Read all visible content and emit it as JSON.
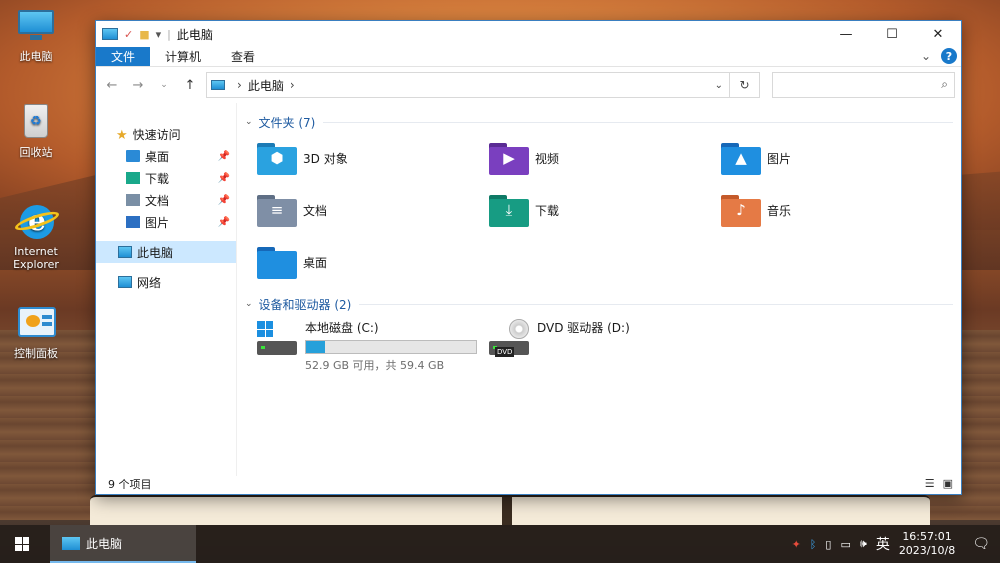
{
  "desktop": {
    "icons": [
      {
        "label": "此电脑"
      },
      {
        "label": "回收站"
      },
      {
        "label": "Internet Explorer"
      },
      {
        "label": "控制面板"
      }
    ]
  },
  "window": {
    "title": "此电脑",
    "ribbon_tabs": [
      "文件",
      "计算机",
      "查看"
    ],
    "address": {
      "location": "此电脑"
    },
    "search": {
      "placeholder": ""
    },
    "nav": {
      "quick_access": "快速访问",
      "pinned": [
        "桌面",
        "下载",
        "文档",
        "图片"
      ],
      "this_pc": "此电脑",
      "network": "网络"
    },
    "folders_header": "文件夹 (7)",
    "folders": [
      {
        "name": "3D 对象",
        "color": "#2aa2e0"
      },
      {
        "name": "视频",
        "color": "#7a3fbf"
      },
      {
        "name": "图片",
        "color": "#1f8fe0"
      },
      {
        "name": "文档",
        "color": "#7f8fa6"
      },
      {
        "name": "下载",
        "color": "#179c83"
      },
      {
        "name": "音乐",
        "color": "#e57a45"
      },
      {
        "name": "桌面",
        "color": "#1f8fe0"
      }
    ],
    "devices_header": "设备和驱动器 (2)",
    "drives": [
      {
        "name": "本地磁盘 (C:)",
        "usage_fraction": 0.11,
        "space": "52.9 GB 可用，共 59.4 GB"
      },
      {
        "name": "DVD 驱动器 (D:)",
        "tag": "DVD"
      }
    ],
    "status": "9 个项目"
  },
  "taskbar": {
    "active_window": "此电脑",
    "ime": "英",
    "time": "16:57:01",
    "date": "2023/10/8"
  }
}
